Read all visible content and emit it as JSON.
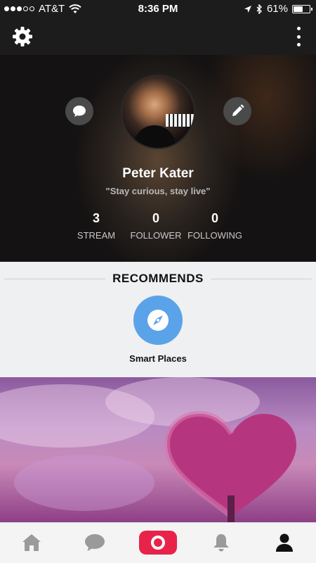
{
  "status_bar": {
    "carrier": "AT&T",
    "time": "8:36 PM",
    "battery_percent": "61%",
    "battery_level": 0.61,
    "signal_bars_filled": 3,
    "signal_bars_total": 5
  },
  "top_bar": {
    "settings_icon": "gear-icon",
    "menu_icon": "vertical-dots-icon"
  },
  "profile": {
    "name": "Peter Kater",
    "bio": "\"Stay curious, stay live\"",
    "stats": [
      {
        "value": "3",
        "label": "STREAM"
      },
      {
        "value": "0",
        "label": "FOLLOWER"
      },
      {
        "value": "0",
        "label": "FOLLOWING"
      }
    ]
  },
  "recommends": {
    "title": "RECOMMENDS",
    "item": {
      "label": "Smart Places",
      "icon": "compass-icon"
    }
  },
  "tab_bar": {
    "tabs": [
      "home-icon",
      "chat-icon",
      "record-icon",
      "bell-icon",
      "profile-icon"
    ],
    "active": "profile-icon"
  },
  "colors": {
    "accent_blue": "#5ba3e8",
    "record_red": "#e8234a",
    "tab_inactive": "#9a9a9a",
    "tab_active": "#111111"
  }
}
